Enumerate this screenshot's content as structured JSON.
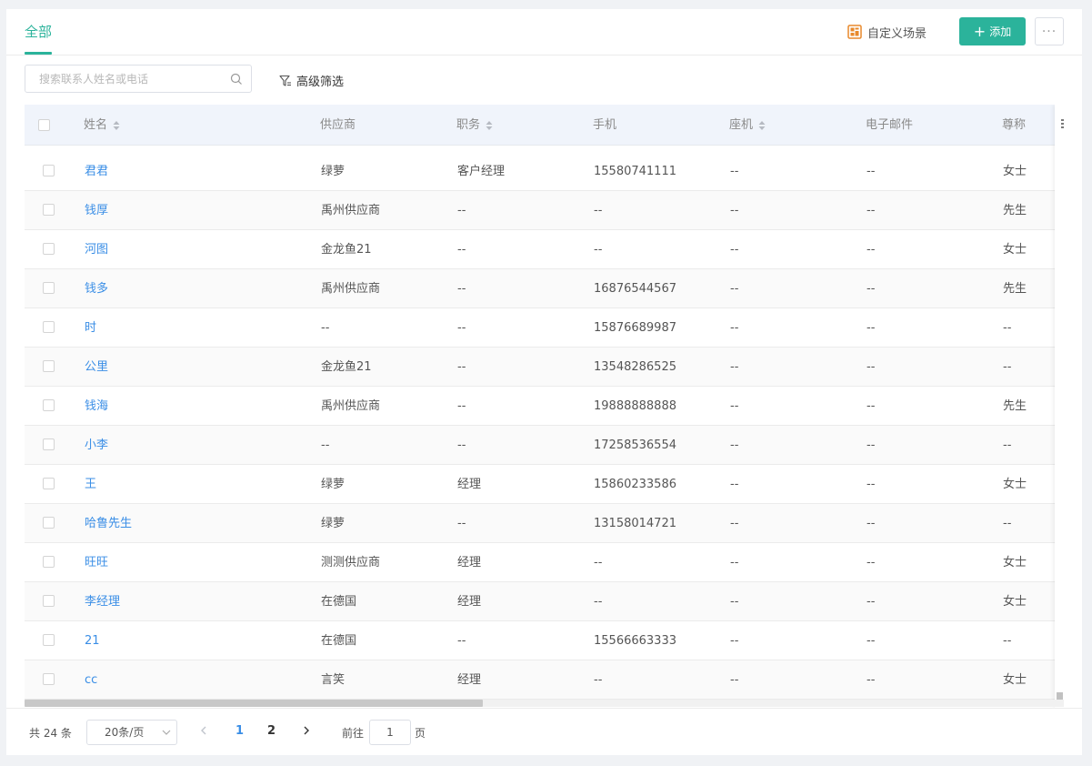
{
  "header": {
    "tab_all": "全部",
    "scene_label": "自定义场景",
    "scene_icon": "dashboard-icon",
    "add_label": "添加",
    "more_label": "···",
    "accent_color": "#2bb39b"
  },
  "toolbar": {
    "search_placeholder": "搜索联系人姓名或电话",
    "filter_label": "高级筛选"
  },
  "table": {
    "columns": [
      "姓名",
      "供应商",
      "职务",
      "手机",
      "座机",
      "电子邮件",
      "尊称"
    ],
    "sortable": [
      true,
      false,
      true,
      false,
      true,
      false,
      false
    ],
    "rows": [
      [
        "君君",
        "绿萝",
        "客户经理",
        "15580741111",
        "--",
        "--",
        "女士"
      ],
      [
        "钱厚",
        "禹州供应商",
        "--",
        "--",
        "--",
        "--",
        "先生"
      ],
      [
        "河图",
        "金龙鱼21",
        "--",
        "--",
        "--",
        "--",
        "女士"
      ],
      [
        "钱多",
        "禹州供应商",
        "--",
        "16876544567",
        "--",
        "--",
        "先生"
      ],
      [
        "时",
        "--",
        "--",
        "15876689987",
        "--",
        "--",
        "--"
      ],
      [
        "公里",
        "金龙鱼21",
        "--",
        "13548286525",
        "--",
        "--",
        "--"
      ],
      [
        "钱海",
        "禹州供应商",
        "--",
        "19888888888",
        "--",
        "--",
        "先生"
      ],
      [
        "小李",
        "--",
        "--",
        "17258536554",
        "--",
        "--",
        "--"
      ],
      [
        "王",
        "绿萝",
        "经理",
        "15860233586",
        "--",
        "--",
        "女士"
      ],
      [
        "哈鲁先生",
        "绿萝",
        "--",
        "13158014721",
        "--",
        "--",
        "--"
      ],
      [
        "旺旺",
        "测测供应商",
        "经理",
        "--",
        "--",
        "--",
        "女士"
      ],
      [
        "李经理",
        "在德国",
        "经理",
        "--",
        "--",
        "--",
        "女士"
      ],
      [
        "21",
        "在德国",
        "--",
        "15566663333",
        "--",
        "--",
        "--"
      ],
      [
        "cc",
        "言笑",
        "经理",
        "--",
        "--",
        "--",
        "女士"
      ]
    ]
  },
  "pagination": {
    "total": "共 24 条",
    "page_size": "20条/页",
    "pages": [
      "1",
      "2"
    ],
    "current_page": "1",
    "goto_label": "前往",
    "goto_value": "1",
    "page_suffix": "页"
  }
}
